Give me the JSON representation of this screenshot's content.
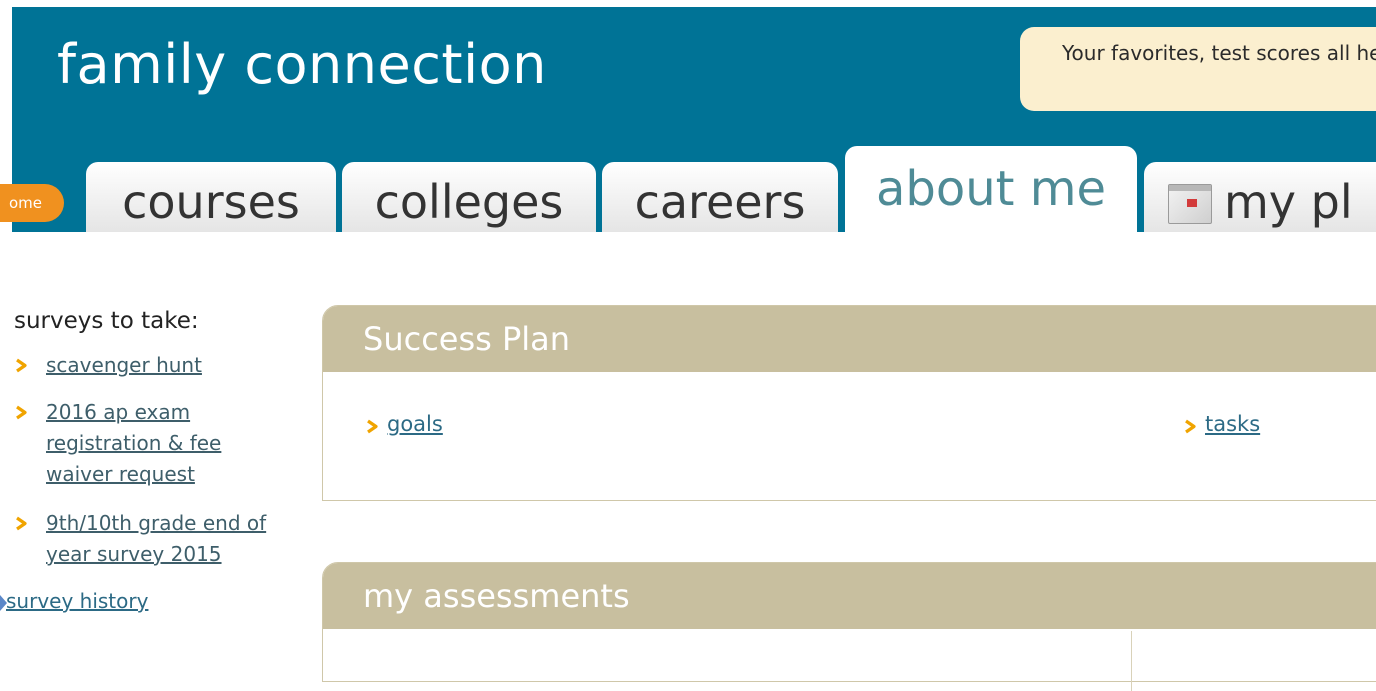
{
  "header": {
    "brand": "family connection",
    "promo_text": "Your favorites, test scores all here!"
  },
  "nav": {
    "home_label": "ome",
    "tabs": [
      {
        "label": "courses"
      },
      {
        "label": "colleges"
      },
      {
        "label": "careers"
      },
      {
        "label": "about me",
        "active": true
      },
      {
        "label": "my pl",
        "icon": "calendar-icon"
      }
    ]
  },
  "sidebar": {
    "title": "surveys to take:",
    "items": [
      {
        "label": "scavenger hunt"
      },
      {
        "label": "2016 ap exam registration & fee waiver request"
      },
      {
        "label": "9th/10th grade end of year survey 2015"
      }
    ],
    "history_label": "survey history"
  },
  "success_plan": {
    "title": "Success Plan",
    "links": [
      "goals",
      "tasks"
    ]
  },
  "assessments": {
    "title": "my assessments"
  },
  "colors": {
    "header_blue": "#007396",
    "accent_orange": "#f0911f",
    "arrow_yellow": "#f0a400",
    "panel_khaki": "#c8bf9f",
    "link_blue": "#2c6a85"
  }
}
